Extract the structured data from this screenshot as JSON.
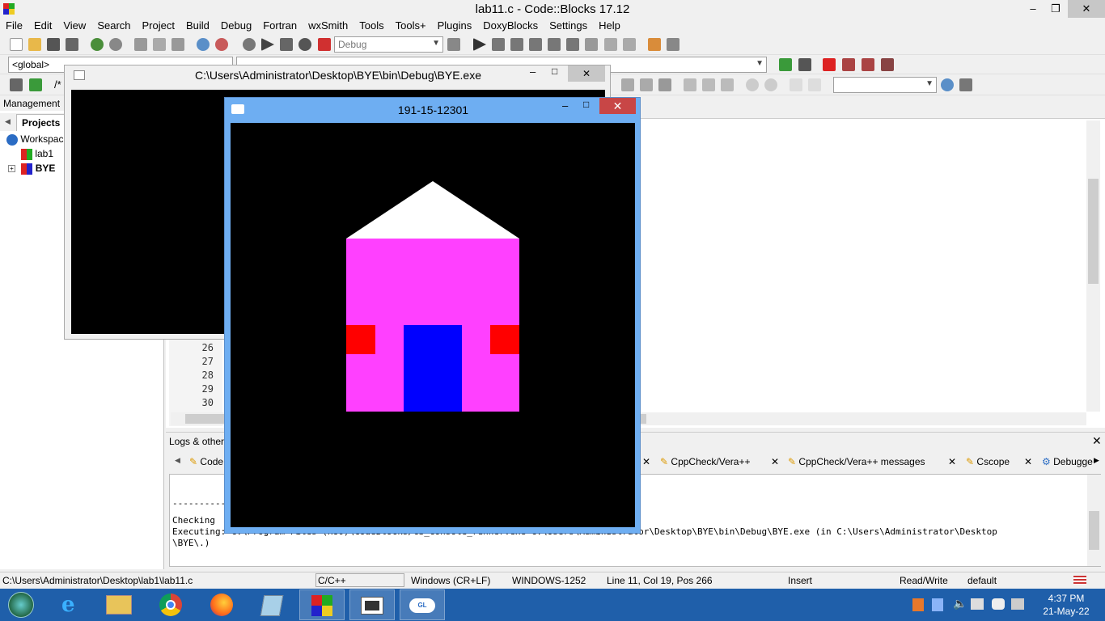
{
  "app": {
    "title": "lab11.c - Code::Blocks 17.12",
    "minimize": "–",
    "maximize": "❐",
    "close": "✕"
  },
  "menu": [
    "File",
    "Edit",
    "View",
    "Search",
    "Project",
    "Build",
    "Debug",
    "Fortran",
    "wxSmith",
    "Tools",
    "Tools+",
    "Plugins",
    "DoxyBlocks",
    "Settings",
    "Help"
  ],
  "toolbar": {
    "build_target": "Debug",
    "scope": "<global>",
    "comment_prefix": "/*"
  },
  "management": {
    "header": "Management",
    "tab": "Projects",
    "workspace": "Workspace",
    "projects": [
      "lab1",
      "BYE"
    ]
  },
  "editor": {
    "line_numbers": [
      "26",
      "27",
      "28",
      "29",
      "30"
    ]
  },
  "logs": {
    "header": "Logs & others",
    "tabs": [
      "Code",
      "CppCheck/Vera++",
      "CppCheck/Vera++ messages",
      "Cscope",
      "Debugge"
    ],
    "lines": [
      "----------",
      "Checking",
      "Executing:  C:\\Program Files (x86)\\CodeBlocks/cb_console_runner.exe  C:\\Users\\Administrator\\Desktop\\BYE\\bin\\Debug\\BYE.exe  (in C:\\Users\\Administrator\\Desktop",
      "\\BYE\\.)"
    ]
  },
  "status": {
    "path": "C:\\Users\\Administrator\\Desktop\\lab1\\lab11.c",
    "lang": "C/C++",
    "eol": "Windows (CR+LF)",
    "encoding": "WINDOWS-1252",
    "position": "Line 11, Col 19, Pos 266",
    "mode": "Insert",
    "access": "Read/Write",
    "profile": "default"
  },
  "console": {
    "title": "C:\\Users\\Administrator\\Desktop\\BYE\\bin\\Debug\\BYE.exe"
  },
  "glut": {
    "title": "191-15-12301",
    "colors": {
      "roof": "#ffffff",
      "wall": "#ff40ff",
      "window": "#ff0000",
      "door": "#0000ff"
    }
  },
  "taskbar": {
    "time": "4:37 PM",
    "date": "21-May-22"
  }
}
